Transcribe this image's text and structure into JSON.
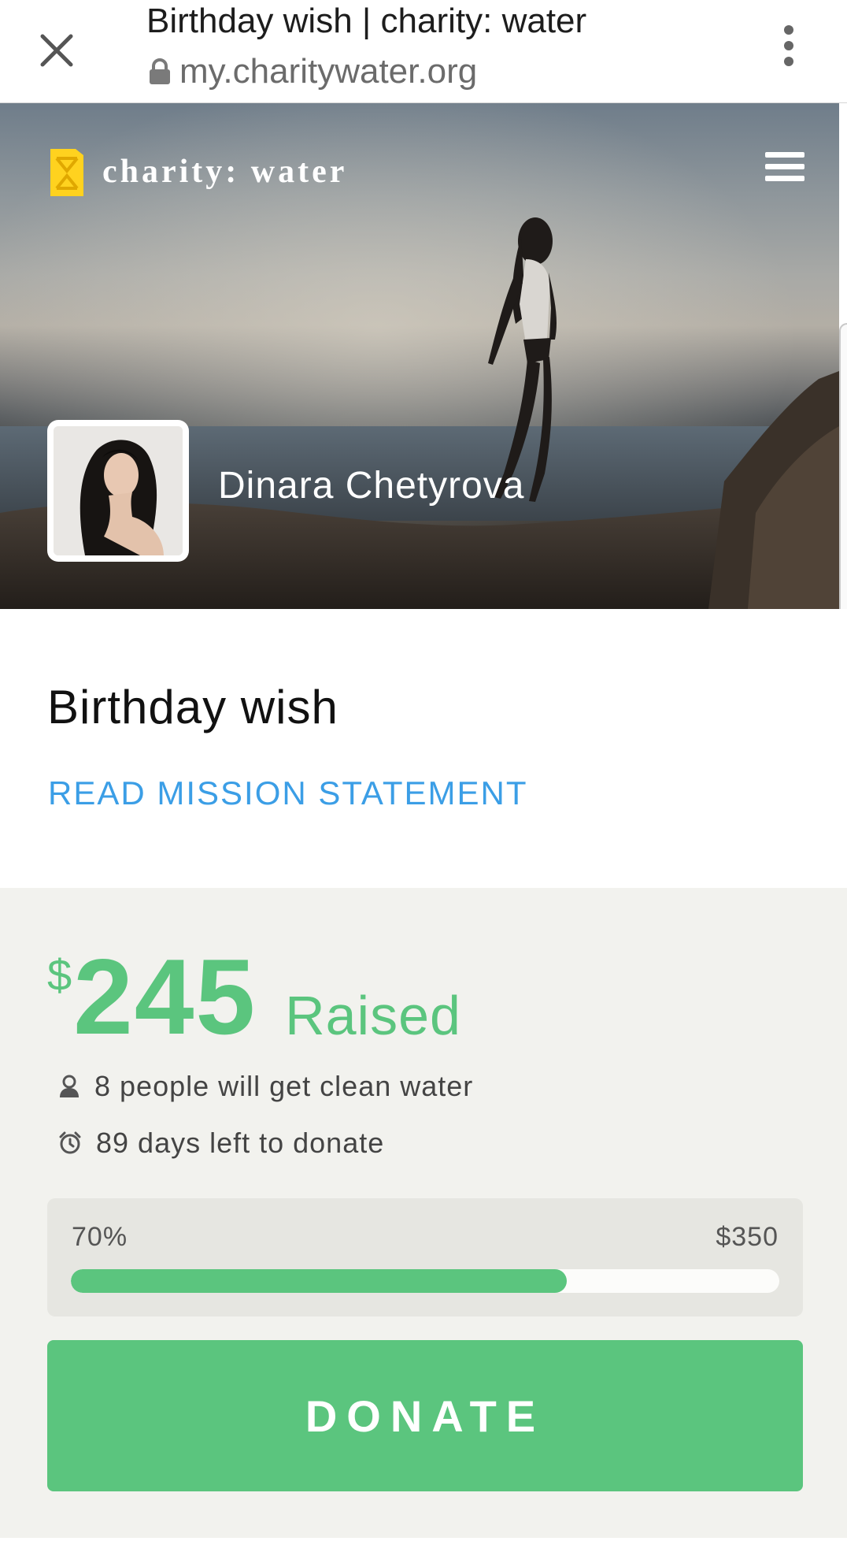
{
  "browser": {
    "page_title": "Birthday wish | charity: water",
    "url": "my.charitywater.org",
    "icons": {
      "close": "close-icon",
      "lock": "lock-icon",
      "overflow": "more-vert-icon"
    }
  },
  "header": {
    "brand_name": "charity: water",
    "menu_icon": "hamburger-menu-icon",
    "logo_color": "#ffd21f"
  },
  "profile": {
    "owner_name": "Dinara Chetyrova"
  },
  "campaign": {
    "title": "Birthday wish",
    "mission_link": "READ MISSION STATEMENT"
  },
  "stats": {
    "currency_symbol": "$",
    "amount_raised": "245",
    "raised_label": "Raised",
    "people_line": "8 people will get clean water",
    "days_line": "89 days left to donate",
    "progress_percent_label": "70%",
    "progress_fraction": 0.7,
    "goal_label": "$350"
  },
  "actions": {
    "donate_label": "DONATE"
  },
  "colors": {
    "accent_green": "#5bc57e",
    "link_blue": "#3b9ee6",
    "stats_bg": "#f2f2ee"
  }
}
